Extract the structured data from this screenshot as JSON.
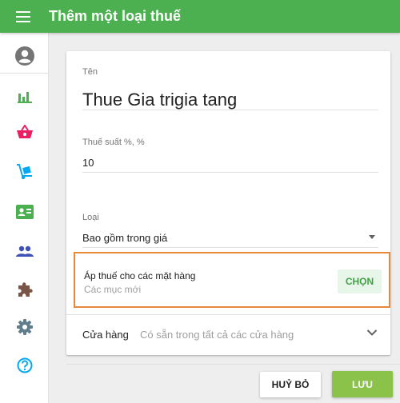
{
  "app_bar": {
    "title": "Thêm một loại thuế",
    "menu_icon": "hamburger-menu-icon",
    "color": "#4caf50"
  },
  "sidebar": {
    "items": [
      {
        "name": "profile",
        "icon": "account-circle-icon",
        "color": "#616161"
      },
      {
        "name": "reports",
        "icon": "bar-chart-icon",
        "color": "#4caf50"
      },
      {
        "name": "sales",
        "icon": "basket-icon",
        "color": "#e91e63"
      },
      {
        "name": "items",
        "icon": "hand-truck-icon",
        "color": "#03a9f4"
      },
      {
        "name": "employees",
        "icon": "badge-card-icon",
        "color": "#4caf50"
      },
      {
        "name": "customers",
        "icon": "people-icon",
        "color": "#3f51b5"
      },
      {
        "name": "apps",
        "icon": "puzzle-icon",
        "color": "#795548"
      },
      {
        "name": "settings",
        "icon": "gear-icon",
        "color": "#607d8b"
      },
      {
        "name": "help",
        "icon": "help-circle-icon",
        "color": "#03a9f4"
      }
    ]
  },
  "form": {
    "name_label": "Tên",
    "name_value": "Thue Gia trigia tang",
    "rate_label": "Thuế suất %, %",
    "rate_value": "10",
    "type_label": "Loại",
    "type_value": "Bao gồm trong giá",
    "apply_title": "Áp thuế cho các mặt hàng",
    "apply_sub": "Các mục mới",
    "choose_label": "CHỌN",
    "store_label": "Cửa hàng",
    "store_value": "Có sẵn trong tất cả các cửa hàng",
    "highlight_color": "#e8893a"
  },
  "actions": {
    "cancel_label": "HUỶ BỎ",
    "save_label": "LƯU",
    "save_color": "#8bc34a"
  }
}
